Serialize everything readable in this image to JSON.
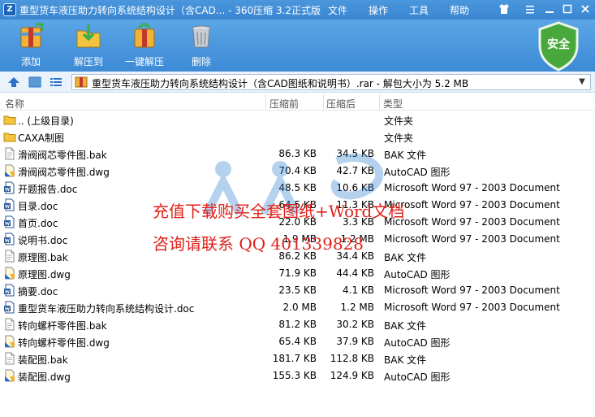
{
  "titlebar": {
    "title": "重型货车液压助力转向系统结构设计（含CAD... - 360压缩 3.2正式版",
    "menu": [
      "文件",
      "操作",
      "工具",
      "帮助"
    ]
  },
  "toolbar": {
    "buttons": [
      {
        "label": "添加",
        "icon": "add-archive-icon"
      },
      {
        "label": "解压到",
        "icon": "extract-to-icon"
      },
      {
        "label": "一键解压",
        "icon": "one-click-extract-icon"
      },
      {
        "label": "删除",
        "icon": "trash-icon"
      }
    ],
    "security_label": "安全"
  },
  "address": {
    "path": "重型货车液压助力转向系统结构设计（含CAD图纸和说明书）.rar - 解包大小为 5.2 MB"
  },
  "columns": {
    "name": "名称",
    "packed": "压缩前",
    "compressed": "压缩后",
    "type": "类型"
  },
  "files": [
    {
      "name": ".. (上级目录)",
      "size": "",
      "packed": "",
      "type": "文件夹",
      "icon": "folder"
    },
    {
      "name": "CAXA制图",
      "size": "",
      "packed": "",
      "type": "文件夹",
      "icon": "folder"
    },
    {
      "name": "滑阀阀芯零件图.bak",
      "size": "86.3 KB",
      "packed": "34.5 KB",
      "type": "BAK 文件",
      "icon": "bak"
    },
    {
      "name": "滑阀阀芯零件图.dwg",
      "size": "70.4 KB",
      "packed": "42.7 KB",
      "type": "AutoCAD 图形",
      "icon": "dwg"
    },
    {
      "name": "开题报告.doc",
      "size": "48.5 KB",
      "packed": "10.6 KB",
      "type": "Microsoft Word 97 - 2003 Document",
      "icon": "doc"
    },
    {
      "name": "目录.doc",
      "size": "64.5 KB",
      "packed": "11.3 KB",
      "type": "Microsoft Word 97 - 2003 Document",
      "icon": "doc"
    },
    {
      "name": "首页.doc",
      "size": "22.0 KB",
      "packed": "3.3 KB",
      "type": "Microsoft Word 97 - 2003 Document",
      "icon": "doc"
    },
    {
      "name": "说明书.doc",
      "size": "1.9 MB",
      "packed": "1.2 MB",
      "type": "Microsoft Word 97 - 2003 Document",
      "icon": "doc"
    },
    {
      "name": "原理图.bak",
      "size": "86.2 KB",
      "packed": "34.4 KB",
      "type": "BAK 文件",
      "icon": "bak"
    },
    {
      "name": "原理图.dwg",
      "size": "71.9 KB",
      "packed": "44.4 KB",
      "type": "AutoCAD 图形",
      "icon": "dwg"
    },
    {
      "name": "摘要.doc",
      "size": "23.5 KB",
      "packed": "4.1 KB",
      "type": "Microsoft Word 97 - 2003 Document",
      "icon": "doc"
    },
    {
      "name": "重型货车液压助力转向系统结构设计.doc",
      "size": "2.0 MB",
      "packed": "1.2 MB",
      "type": "Microsoft Word 97 - 2003 Document",
      "icon": "doc"
    },
    {
      "name": "转向螺杆零件图.bak",
      "size": "81.2 KB",
      "packed": "30.2 KB",
      "type": "BAK 文件",
      "icon": "bak"
    },
    {
      "name": "转向螺杆零件图.dwg",
      "size": "65.4 KB",
      "packed": "37.9 KB",
      "type": "AutoCAD 图形",
      "icon": "dwg"
    },
    {
      "name": "装配图.bak",
      "size": "181.7 KB",
      "packed": "112.8 KB",
      "type": "BAK 文件",
      "icon": "bak"
    },
    {
      "name": "装配图.dwg",
      "size": "155.3 KB",
      "packed": "124.9 KB",
      "type": "AutoCAD 图形",
      "icon": "dwg"
    }
  ],
  "watermark": {
    "line1": "充值下载购买全套图纸+Word文档",
    "line2": "咨询请联系   QQ 401339828"
  },
  "colors": {
    "titlebar": "#3a85d1",
    "toolbar": "#4a98de",
    "shield": "#49a83b",
    "watermark_text": "#e0201a",
    "watermark_logo": "#2a7fd0"
  }
}
